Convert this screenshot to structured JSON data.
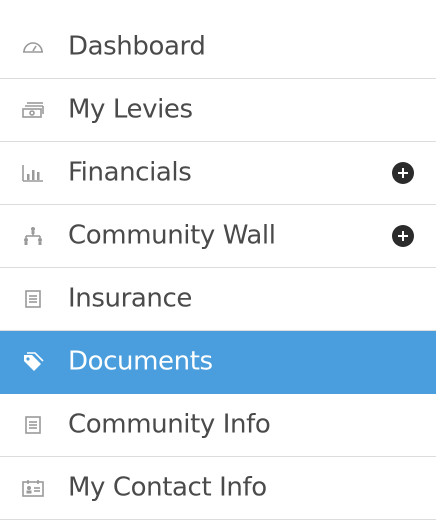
{
  "nav": {
    "items": [
      {
        "label": "Dashboard",
        "icon": "dashboard-gauge-icon",
        "active": false,
        "expandable": false
      },
      {
        "label": "My Levies",
        "icon": "cash-stack-icon",
        "active": false,
        "expandable": false
      },
      {
        "label": "Financials",
        "icon": "bar-chart-icon",
        "active": false,
        "expandable": true
      },
      {
        "label": "Community Wall",
        "icon": "people-hierarchy-icon",
        "active": false,
        "expandable": true
      },
      {
        "label": "Insurance",
        "icon": "document-list-icon",
        "active": false,
        "expandable": false
      },
      {
        "label": "Documents",
        "icon": "documents-tag-icon",
        "active": true,
        "expandable": false
      },
      {
        "label": "Community Info",
        "icon": "document-list-icon",
        "active": false,
        "expandable": false
      },
      {
        "label": "My Contact Info",
        "icon": "contact-card-icon",
        "active": false,
        "expandable": false
      }
    ]
  },
  "colors": {
    "active_bg": "#4a9ede",
    "text": "#4a4a4a",
    "icon": "#9a9a9a",
    "divider": "#dcdcdc",
    "expand_button": "#2b2b2b"
  }
}
